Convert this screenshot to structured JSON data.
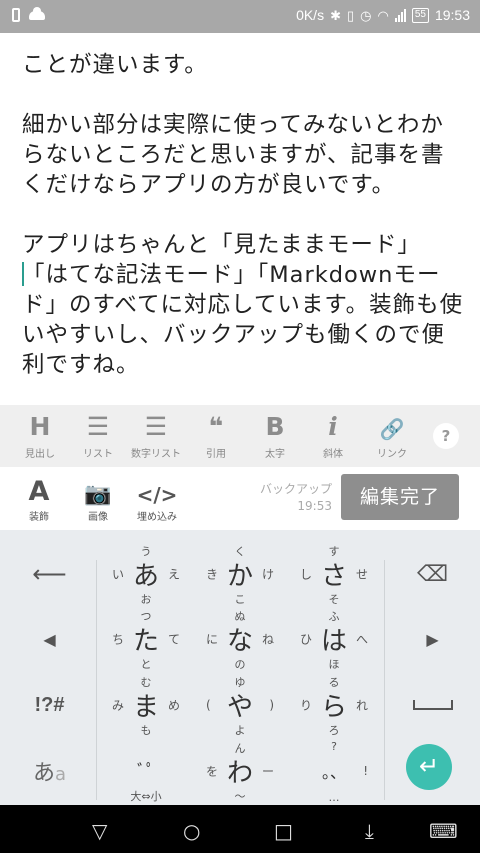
{
  "status": {
    "speed": "0K/s",
    "battery": "55",
    "time": "19:53"
  },
  "editor": {
    "line1": "ことが違います。",
    "para2": "細かい部分は実際に使ってみないとわからないところだと思いますが、記事を書くだけならアプリの方が良いです。",
    "para3_line1": "アプリはちゃんと「見たままモード」",
    "para3_rest": "「はてな記法モード」「Markdownモード」のすべてに対応しています。装飾も使いやすいし、バックアップも働くので便利ですね。"
  },
  "format_row1": [
    {
      "icon": "H",
      "label": "見出し"
    },
    {
      "icon": "☰",
      "label": "リスト"
    },
    {
      "icon": "☰",
      "label": "数字リスト"
    },
    {
      "icon": "❝",
      "label": "引用"
    },
    {
      "icon": "B",
      "label": "太字"
    },
    {
      "icon": "i",
      "label": "斜体"
    },
    {
      "icon": "🔗",
      "label": "リンク"
    }
  ],
  "help": "?",
  "format_row2": [
    {
      "icon": "A",
      "label": "装飾"
    },
    {
      "icon": "📷",
      "label": "画像"
    },
    {
      "icon": "</>",
      "label": "埋め込み"
    }
  ],
  "backup": {
    "label": "バックアップ",
    "time": "19:53"
  },
  "done_button": "編集完了",
  "keyboard": {
    "keys": [
      {
        "c": "あ",
        "u": "う",
        "l": "い",
        "r": "え",
        "d": "お"
      },
      {
        "c": "か",
        "u": "く",
        "l": "き",
        "r": "け",
        "d": "こ"
      },
      {
        "c": "さ",
        "u": "す",
        "l": "し",
        "r": "せ",
        "d": "そ"
      },
      {
        "c": "た",
        "u": "つ",
        "l": "ち",
        "r": "て",
        "d": "と"
      },
      {
        "c": "な",
        "u": "ぬ",
        "l": "に",
        "r": "ね",
        "d": "の"
      },
      {
        "c": "は",
        "u": "ふ",
        "l": "ひ",
        "r": "へ",
        "d": "ほ"
      },
      {
        "c": "ま",
        "u": "む",
        "l": "み",
        "r": "め",
        "d": "も"
      },
      {
        "c": "や",
        "u": "ゆ",
        "l": "(",
        "r": ")",
        "d": "よ"
      },
      {
        "c": "ら",
        "u": "る",
        "l": "り",
        "r": "れ",
        "d": "ろ"
      },
      {
        "c": "ﾞﾟ",
        "u": "",
        "l": "",
        "r": "",
        "d": "大⇔小"
      },
      {
        "c": "わ",
        "u": "ん",
        "l": "を",
        "r": "ー",
        "d": "〜"
      },
      {
        "c": "。、",
        "u": "?",
        "l": "",
        "r": "!",
        "d": "…"
      }
    ],
    "symbols_label": "!?#",
    "kana_label": "あ",
    "kana_sub": "a"
  },
  "colors": {
    "accent": "#3dbfb0",
    "status_bar": "#a8a8a8",
    "toolbar": "#efefef",
    "keyboard": "#e9ecef"
  }
}
